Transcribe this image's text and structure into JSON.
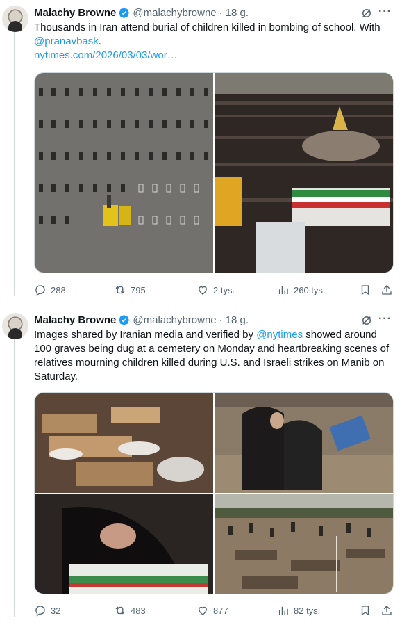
{
  "tweets": [
    {
      "author": "Malachy Browne",
      "handle": "@malachybrowne",
      "time": "18 g.",
      "text_part1": "Thousands in Iran attend burial of children killed in bombing of school. With",
      "mention": "@pranavbask",
      "text_after_mention": ".",
      "link": "nytimes.com/2026/03/03/wor…",
      "replies": "288",
      "reposts": "795",
      "likes": "2 tys.",
      "views": "260 tys."
    },
    {
      "author": "Malachy Browne",
      "handle": "@malachybrowne",
      "time": "18 g.",
      "text_part1": "Images shared by Iranian media and verified by",
      "mention": "@nytimes",
      "text_part2": "showed around 100 graves being dug at a cemetery on Monday and heartbreaking scenes of relatives mourning children killed during U.S. and Israeli strikes on Manib on Saturday.",
      "replies": "32",
      "reposts": "483",
      "likes": "877",
      "views": "82 tys."
    }
  ],
  "colors": {
    "accent": "#1d9bf0",
    "muted": "#536471",
    "verified": "#1d9bf0"
  },
  "icons": [
    "verified-badge-icon",
    "grok-icon",
    "more-icon",
    "reply-icon",
    "repost-icon",
    "like-icon",
    "views-icon",
    "bookmark-icon",
    "share-icon"
  ]
}
